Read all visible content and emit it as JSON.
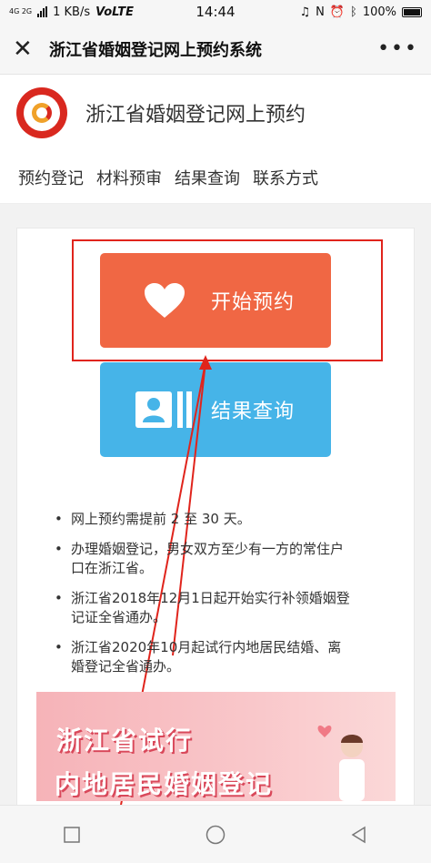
{
  "status": {
    "network_left": "4G  2G",
    "speed": "1 KB/s",
    "volte": "VoLTE",
    "time": "14:44",
    "battery": "100%"
  },
  "titlebar": {
    "title": "浙江省婚姻登记网上预约系统",
    "close_icon": "close-icon",
    "more_icon": "more-icon"
  },
  "header": {
    "site_title": "浙江省婚姻登记网上预约"
  },
  "nav": {
    "items": [
      {
        "label": "预约登记"
      },
      {
        "label": "材料预审"
      },
      {
        "label": "结果查询"
      },
      {
        "label": "联系方式"
      }
    ]
  },
  "buttons": {
    "start_label": "开始预约",
    "start_icon": "heart-icon",
    "start_color": "#f06744",
    "query_label": "结果查询",
    "query_icon": "contact-card-icon",
    "query_color": "#46b4e8"
  },
  "notes": [
    "网上预约需提前 2 至 30 天。",
    "办理婚姻登记，男女双方至少有一方的常住户口在浙江省。",
    "浙江省2018年12月1日起开始实行补领婚姻登记证全省通办。",
    "浙江省2020年10月起试行内地居民结婚、离婚登记全省通办。"
  ],
  "banner": {
    "line1": "浙江省试行",
    "line2": "内地居民婚姻登记"
  },
  "colors": {
    "annotation_red": "#e0241c"
  }
}
